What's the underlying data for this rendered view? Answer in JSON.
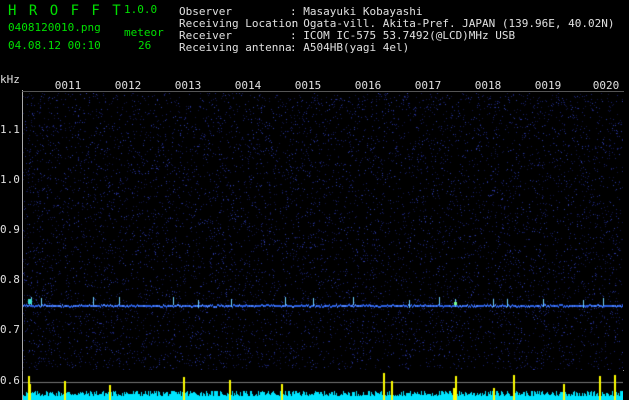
{
  "header": {
    "logo": "H R O F F T",
    "version": "1.0.0",
    "filename": "0408120010.png",
    "datetime": "04.08.12 00:10",
    "meteor_label": "meteor",
    "meteor_count": "26",
    "info": [
      {
        "label": "Observer",
        "value": ": Masayuki Kobayashi"
      },
      {
        "label": "Receiving Location",
        "value": ": Ogata-vill. Akita-Pref. JAPAN (139.96E, 40.02N)"
      },
      {
        "label": "Receiver",
        "value": ": ICOM IC-575 53.7492(@LCD)MHz USB"
      },
      {
        "label": "Receiving antenna",
        "value": ": A504HB(yagi 4el)"
      }
    ]
  },
  "axis": {
    "y_unit": "kHz",
    "y_ticks": [
      "1.1",
      "1.0",
      "0.9",
      "0.8",
      "0.7",
      "0.6"
    ],
    "x_ticks": [
      "0011",
      "0012",
      "0013",
      "0014",
      "0015",
      "0016",
      "0017",
      "0018",
      "0019",
      "0020"
    ]
  },
  "colors": {
    "background": "#000000",
    "noise": "#1a237e",
    "signal": "#2962ff",
    "meteor": "#00e5ff",
    "bottom_fill": "#00e5ff",
    "bottom_peak": "#ffff00",
    "header_green": "#00e000"
  },
  "signal": {
    "carrier_khz": 0.75
  }
}
